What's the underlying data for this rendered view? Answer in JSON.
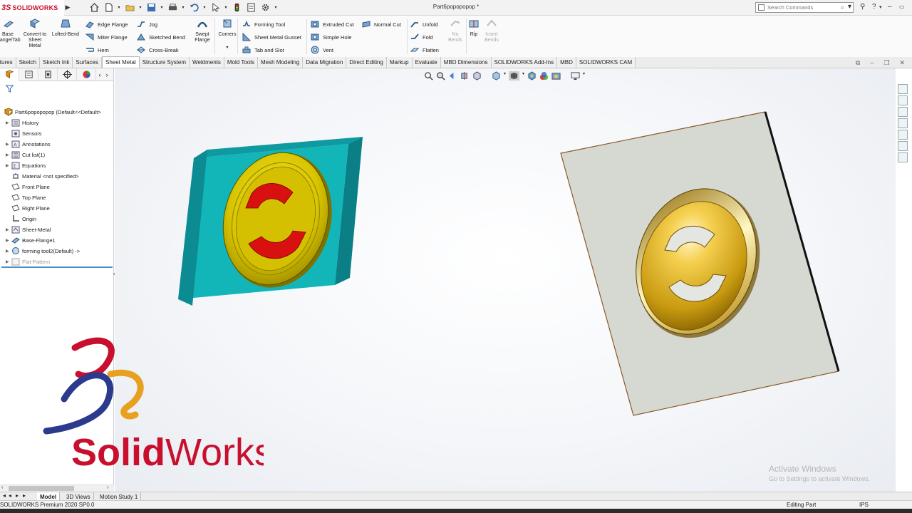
{
  "app": {
    "logo_prefix": "3S",
    "logo_text": "SOLIDWORKS",
    "document_title": "Part6popopopop *",
    "search_placeholder": "Search Commands"
  },
  "ribbon": {
    "base_flange": "Base Flange/Tab",
    "convert": "Convert to Sheet Metal",
    "lofted_bend": "Lofted-Bend",
    "edge_flange": "Edge Flange",
    "miter_flange": "Miter Flange",
    "hem": "Hem",
    "jog": "Jog",
    "sketched_bend": "Sketched Bend",
    "cross_break": "Cross-Break",
    "swept_flange": "Swept Flange",
    "corners": "Corners",
    "forming_tool": "Forming Tool",
    "sheet_metal_gusset": "Sheet Metal Gusset",
    "tab_and_slot": "Tab and Slot",
    "extruded_cut": "Extruded Cut",
    "simple_hole": "Simple Hole",
    "vent": "Vent",
    "normal_cut": "Normal Cut",
    "unfold": "Unfold",
    "fold": "Fold",
    "flatten": "Flatten",
    "no_bends": "No Bends",
    "rip": "Rip",
    "insert_bends": "Insert Bends"
  },
  "tabs": [
    "Features",
    "Sketch",
    "Sketch Ink",
    "Surfaces",
    "Sheet Metal",
    "Structure System",
    "Weldments",
    "Mold Tools",
    "Mesh Modeling",
    "Data Migration",
    "Direct Editing",
    "Markup",
    "Evaluate",
    "MBD Dimensions",
    "SOLIDWORKS Add-Ins",
    "MBD",
    "SOLIDWORKS CAM"
  ],
  "active_tab": "Sheet Metal",
  "tree": {
    "root": "Part6popopopop  (Default<<Default>",
    "items": [
      {
        "label": "History",
        "expandable": true
      },
      {
        "label": "Sensors",
        "expandable": false
      },
      {
        "label": "Annotations",
        "expandable": true
      },
      {
        "label": "Cut list(1)",
        "expandable": true
      },
      {
        "label": "Equations",
        "expandable": true
      },
      {
        "label": "Material <not specified>",
        "expandable": false
      },
      {
        "label": "Front Plane",
        "expandable": false
      },
      {
        "label": "Top Plane",
        "expandable": false
      },
      {
        "label": "Right Plane",
        "expandable": false
      },
      {
        "label": "Origin",
        "expandable": false
      },
      {
        "label": "Sheet-Metal",
        "expandable": true
      },
      {
        "label": "Base-Flange1",
        "expandable": true
      },
      {
        "label": "forming tool2(Default) ->",
        "expandable": true
      },
      {
        "label": "Flat-Pattern",
        "expandable": true
      }
    ]
  },
  "bottom_tabs": [
    "Model",
    "3D Views",
    "Motion Study 1"
  ],
  "active_bottom_tab": "Model",
  "status": {
    "version": "SOLIDWORKS Premium 2020 SP0.0",
    "mode": "Editing Part",
    "units": "IPS"
  },
  "watermark": {
    "line1": "Activate Windows",
    "line2": "Go to Settings to activate Windows."
  },
  "overlay_logo": {
    "text_a": "Solid",
    "text_b": "Works"
  },
  "colors": {
    "brand_red": "#c8102e",
    "teal_block": "#12b5b8",
    "gold": "#e8c000",
    "red_cut": "#d81010"
  }
}
